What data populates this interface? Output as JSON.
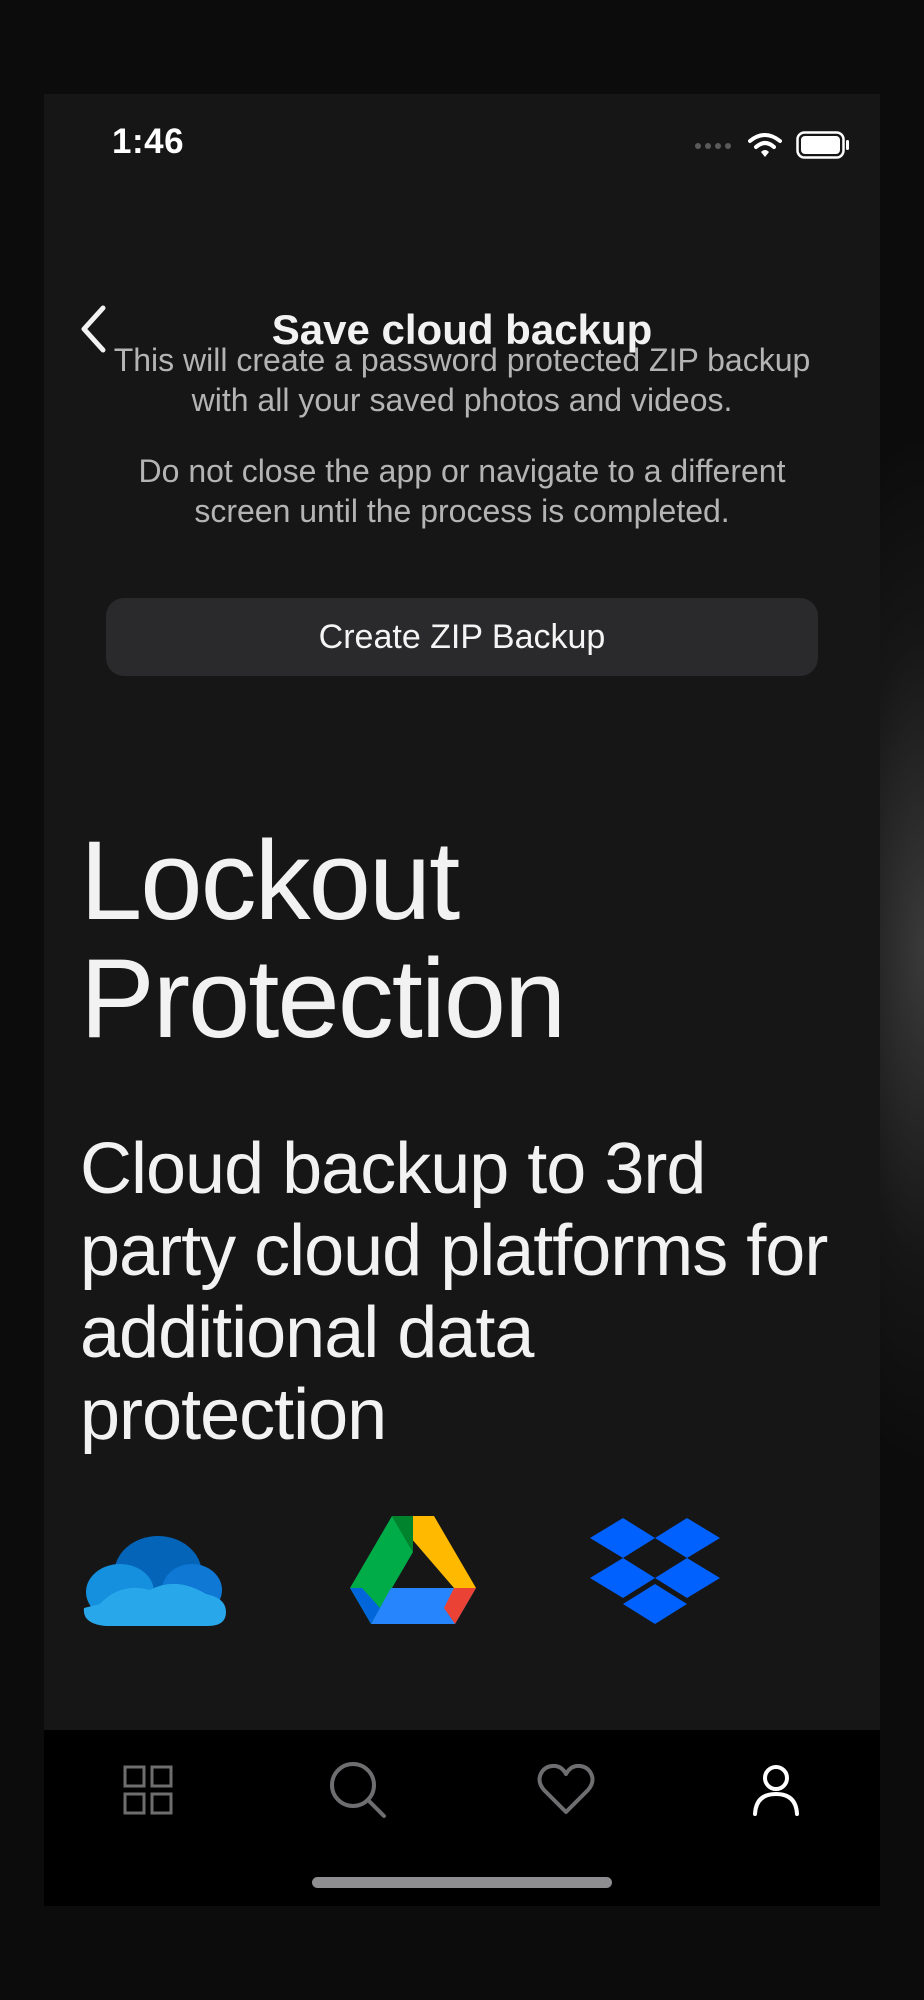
{
  "status_bar": {
    "time": "1:46",
    "icons": [
      "cellular-signal-icon",
      "wifi-icon",
      "battery-icon"
    ]
  },
  "nav": {
    "back_icon": "chevron-left-icon",
    "title": "Save cloud backup"
  },
  "content": {
    "info_line1": "This will create a password protected ZIP backup with all your saved photos and videos.",
    "info_line2": "Do not close the app or navigate to a different screen until the process is completed.",
    "button_label": "Create ZIP Backup",
    "headline": "Lockout Protection",
    "subhead": "Cloud backup to 3rd party cloud platforms for additional data protection",
    "logos": [
      "onedrive-logo",
      "google-drive-logo",
      "dropbox-logo"
    ]
  },
  "tab_bar": {
    "tabs": [
      {
        "icon": "grid-icon",
        "active": false
      },
      {
        "icon": "search-icon",
        "active": false
      },
      {
        "icon": "heart-icon",
        "active": false
      },
      {
        "icon": "person-icon",
        "active": true
      }
    ]
  },
  "colors": {
    "background": "#161617",
    "button": "#2a2a2c",
    "text_primary": "#f2f2f2",
    "text_secondary": "#b4b4b4",
    "tab_inactive": "#6e6e70",
    "tab_active": "#ffffff"
  }
}
